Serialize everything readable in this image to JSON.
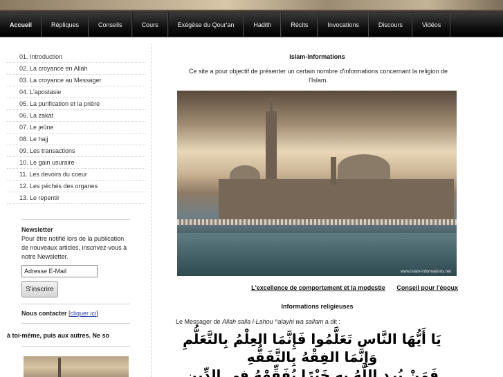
{
  "nav": {
    "items": [
      "Accueil",
      "Répliques",
      "Conseils",
      "Cours",
      "Exégèse du Qour'an",
      "Hadith",
      "Récits",
      "Invocations",
      "Discours",
      "Vidéos"
    ]
  },
  "sidebar": {
    "chapters": [
      "01. Introduction",
      "02. La croyance en Allah",
      "03. La croyance au Messager",
      "04. L'apostasie",
      "05. La purification et la prière",
      "06. La zakat",
      "07. Le jeûne",
      "08. Le hajj",
      "09. Les transactions",
      "10. Le gain usuraire",
      "11. Les devoirs du coeur",
      "12. Les péchés des organes",
      "13. Le repentir"
    ],
    "newsletter": {
      "title": "Newsletter",
      "text": "Pour être notifié lors de la publication de nouveaux articles, inscrivez-vous à notre Newsletter.",
      "email_value": "Adresse E-Mail",
      "button": "S'inscrire"
    },
    "contact": {
      "label": "Nous contacter",
      "bracket_open": "[",
      "link": "cliquer ici",
      "bracket_close": "]"
    },
    "marquee": "à toi-même, puis aux autres. Ne so"
  },
  "main": {
    "title": "Islam-Informations",
    "intro": "Ce site a pour objectif de présenter un certain nombre d'informations concernant la religion de l'Islam.",
    "photo_watermark": "www.islam-informations.net",
    "links": [
      "L'excellence de comportement et la modestie",
      "Conseil pour l'époux"
    ],
    "section_title": "Informations religieuses",
    "messenger": {
      "prefix": "Le Messager de",
      "allah": "Allah",
      "salla": "salla l-Lahou ^alayhi wa sallam",
      "suffix": "a dit :"
    },
    "arabic_lines": [
      "يَا أَيُّهَا النَّاس تَعَلَّمُوا فَإِنَّمَا العِلْمُ بِالتَّعَلُّمِ",
      "وَإِنَّمَا الفِقْهُ بِالتَّفَقُّهِ",
      "فَمَنْ يُرِدِ اللَّهُ بِهِ خَيْرًا يُفَقِّهْهُ فِي الدِّينِ"
    ]
  }
}
